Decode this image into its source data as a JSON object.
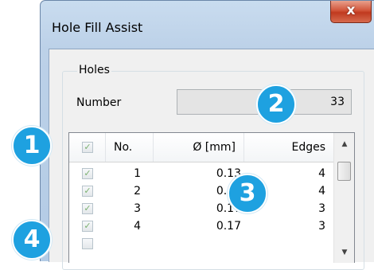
{
  "window": {
    "title": "Hole Fill Assist",
    "close_glyph": "x"
  },
  "holes_group": {
    "label": "Holes",
    "number_label": "Number",
    "number_value": "33"
  },
  "list": {
    "columns": {
      "check": "✓",
      "no": "No.",
      "diameter": "Ø [mm]",
      "edges": "Edges"
    },
    "rows": [
      {
        "check": "✓",
        "no": "1",
        "diameter": "0.13",
        "edges": "4"
      },
      {
        "check": "✓",
        "no": "2",
        "diameter": "0.15",
        "edges": "4"
      },
      {
        "check": "✓",
        "no": "3",
        "diameter": "0.17",
        "edges": "3"
      },
      {
        "check": "✓",
        "no": "4",
        "diameter": "0.17",
        "edges": "3"
      }
    ],
    "scroll_up_glyph": "▲",
    "scroll_down_glyph": "▼"
  },
  "callouts": [
    "1",
    "2",
    "3",
    "4"
  ],
  "colors": {
    "callout": "#1ea1e0",
    "checkmark": "#7bb16f",
    "close_button": "#c0391f"
  }
}
